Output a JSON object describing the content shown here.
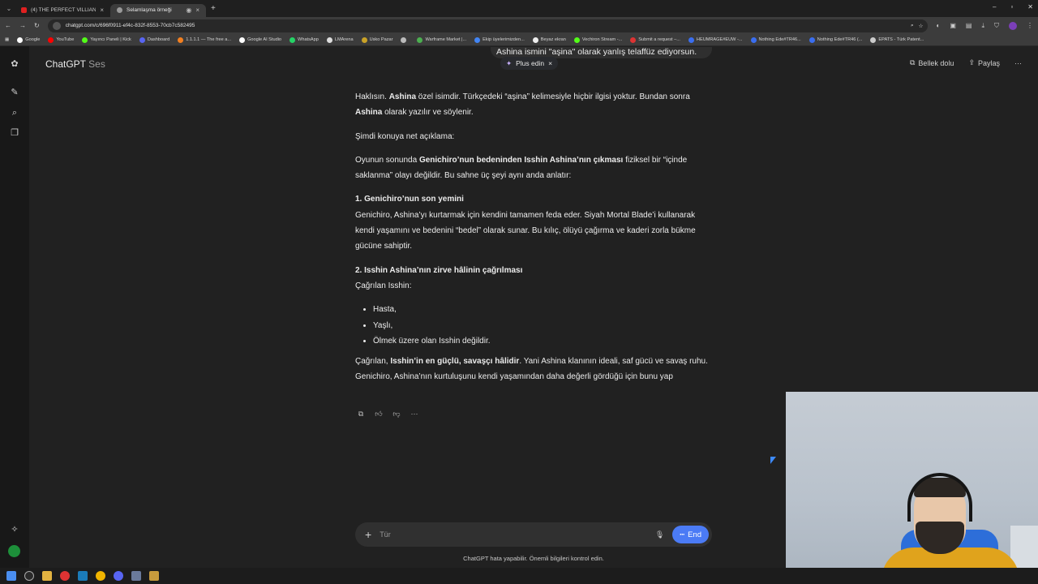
{
  "browser": {
    "tabs": [
      {
        "label": "(4) THE PERFECT VILLIAN DOES...",
        "fav_color": "#e02020"
      },
      {
        "label": "Selamlaşma örneği",
        "fav_color": "#9a9a9a"
      }
    ],
    "url": "chatgpt.com/c/696f0911-ef4c-832f-8553-70cb7c582495",
    "bookmarks": [
      {
        "label": "Google",
        "color": "#ffffff"
      },
      {
        "label": "YouTube",
        "color": "#ff0000"
      },
      {
        "label": "Yayıncı Paneli | Kick",
        "color": "#53fc18"
      },
      {
        "label": "Dashboard",
        "color": "#5865f2"
      },
      {
        "label": "1.1.1.1 — The free a...",
        "color": "#f38020"
      },
      {
        "label": "Google AI Studio",
        "color": "#ffffff"
      },
      {
        "label": "WhatsApp",
        "color": "#25d366"
      },
      {
        "label": "LMArena",
        "color": "#dddddd"
      },
      {
        "label": "Usko Pazar",
        "color": "#c9a227"
      },
      {
        "label": "",
        "color": "#bbbbbb"
      },
      {
        "label": "Warframe Market |...",
        "color": "#4caf50"
      },
      {
        "label": "Ekip üyelerimizden...",
        "color": "#4285f4"
      },
      {
        "label": "Beyaz ekran",
        "color": "#eeeeee"
      },
      {
        "label": "Vechiron Stream -...",
        "color": "#53fc18"
      },
      {
        "label": "Submit a request –...",
        "color": "#d33"
      },
      {
        "label": "HEUMRAGE#EUW -...",
        "color": "#3a6ef0"
      },
      {
        "label": "Nothing Ede#TR46...",
        "color": "#3a6ef0"
      },
      {
        "label": "Nothing Ede#TR46 (...",
        "color": "#3a6ef0"
      },
      {
        "label": "EPATS - Türk Patent...",
        "color": "#cccccc"
      }
    ]
  },
  "header": {
    "title": "ChatGPT",
    "subtitle": "Ses",
    "memory": "Bellek dolu",
    "share": "Paylaş"
  },
  "banner": {
    "text": "Ashina ismini \"aşina\" olarak yanlış telaffüz ediyorsun.",
    "plus_label": "Plus edin"
  },
  "message": {
    "p1_pre": "Haklısın. ",
    "p1_b1": "Ashina",
    "p1_mid": " özel isimdir. Türkçedeki “aşina” kelimesiyle hiçbir ilgisi yoktur. Bundan sonra ",
    "p1_b2": "Ashina",
    "p1_post": " olarak yazılır ve söylenir.",
    "p2": "Şimdi konuya net açıklama:",
    "p3_pre": "Oyunun sonunda ",
    "p3_b": "Genichiro’nun bedeninden Isshin Ashina’nın çıkması",
    "p3_post": " fiziksel bir “içinde saklanma” olayı değildir. Bu sahne üç şeyi aynı anda anlatır:",
    "h1": "1. Genichiro’nun son yemini",
    "p4": "Genichiro, Ashina’yı kurtarmak için kendini tamamen feda eder. Siyah Mortal Blade’i kullanarak kendi yaşamını ve bedenini “bedel” olarak sunar. Bu kılıç, ölüyü çağırma ve kaderi zorla bükme gücüne sahiptir.",
    "h2": "2. Isshin Ashina’nın zirve hâlinin çağrılması",
    "p5": "Çağrılan Isshin:",
    "list": [
      "Hasta,",
      "Yaşlı,",
      "Ölmek üzere olan Isshin değildir."
    ],
    "p6_pre": "Çağrılan, ",
    "p6_b": "Isshin’in en güçlü, savaşçı hâlidir",
    "p6_post": ". Yani Ashina klanının ideali, saf gücü ve savaş ruhu. Genichiro, Ashina’nın kurtuluşunu kendi yaşamından daha değerli gördüğü için bunu yap"
  },
  "composer": {
    "placeholder": "Tür",
    "end_label": "End"
  },
  "disclaimer": "ChatGPT hata yapabilir. Önemli bilgileri kontrol edin.",
  "icons": {
    "copy": "copy-icon",
    "like": "thumbs-up-icon",
    "dislike": "thumbs-down-icon",
    "more": "more-icon"
  }
}
